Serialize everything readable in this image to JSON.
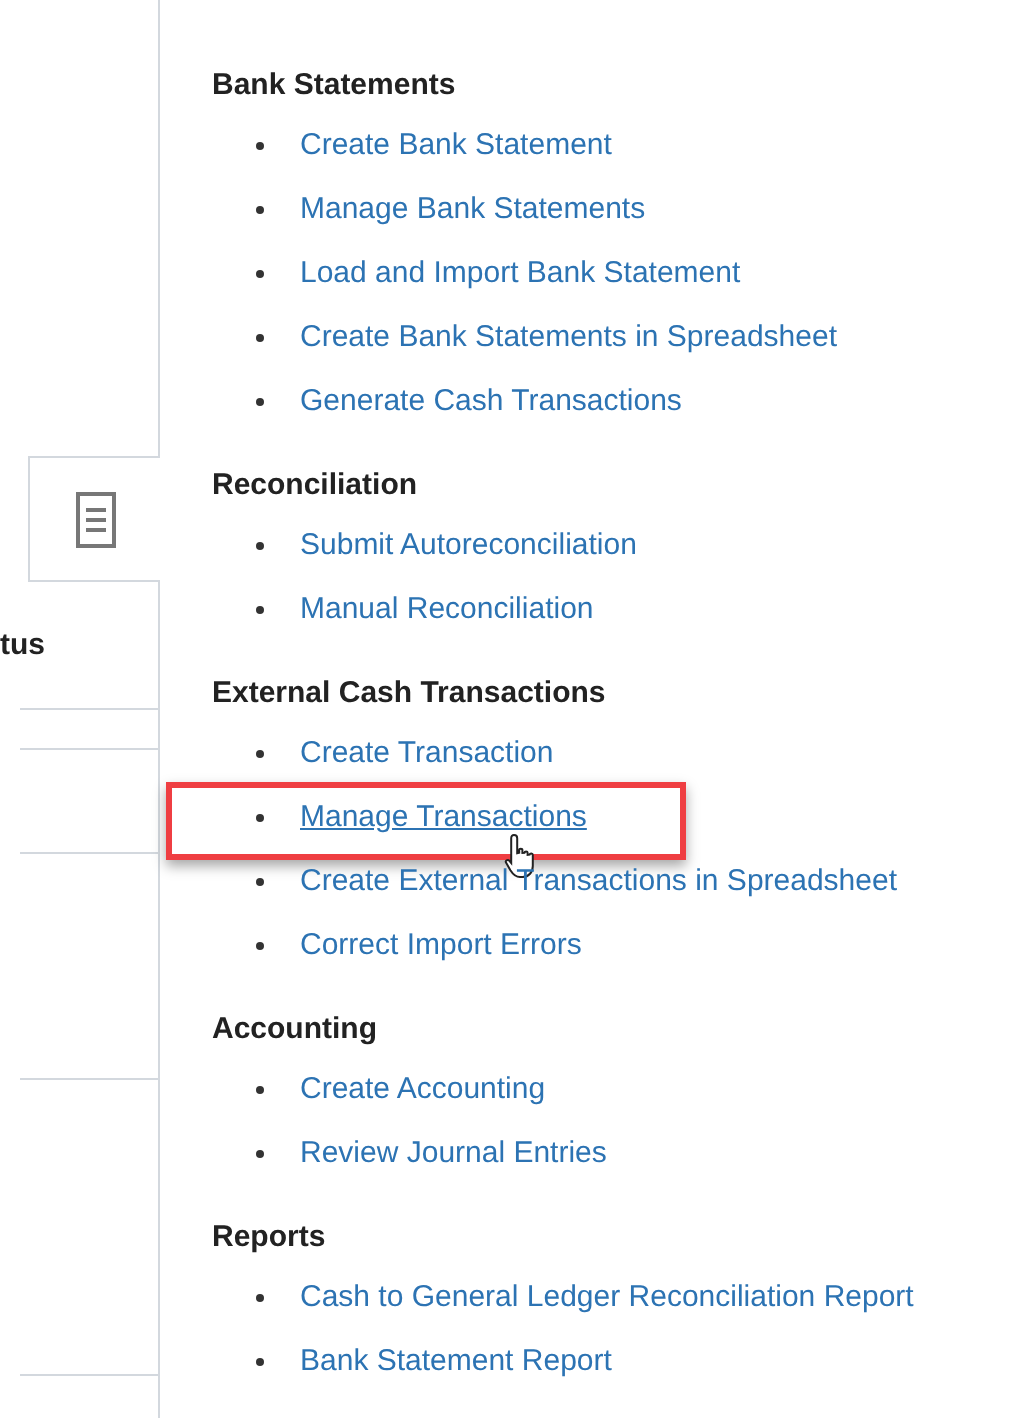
{
  "side_panel": {
    "tab": {
      "selected": true
    },
    "column_heading": "tus"
  },
  "sections": [
    {
      "heading": "Bank Statements",
      "links": [
        {
          "label": "Create Bank Statement",
          "highlighted": false
        },
        {
          "label": "Manage Bank Statements",
          "highlighted": false
        },
        {
          "label": "Load and Import Bank Statement",
          "highlighted": false
        },
        {
          "label": "Create Bank Statements in Spreadsheet",
          "highlighted": false
        },
        {
          "label": "Generate Cash Transactions",
          "highlighted": false
        }
      ]
    },
    {
      "heading": "Reconciliation",
      "links": [
        {
          "label": "Submit Autoreconciliation",
          "highlighted": false
        },
        {
          "label": "Manual Reconciliation",
          "highlighted": false
        }
      ]
    },
    {
      "heading": "External Cash Transactions",
      "links": [
        {
          "label": "Create Transaction",
          "highlighted": false
        },
        {
          "label": "Manage Transactions",
          "highlighted": true
        },
        {
          "label": "Create External Transactions in Spreadsheet",
          "highlighted": false
        },
        {
          "label": "Correct Import Errors",
          "highlighted": false
        }
      ]
    },
    {
      "heading": "Accounting",
      "links": [
        {
          "label": "Create Accounting",
          "highlighted": false
        },
        {
          "label": "Review Journal Entries",
          "highlighted": false
        }
      ]
    },
    {
      "heading": "Reports",
      "links": [
        {
          "label": "Cash to General Ledger Reconciliation Report",
          "highlighted": false
        },
        {
          "label": "Bank Statement Report",
          "highlighted": false
        }
      ]
    }
  ]
}
